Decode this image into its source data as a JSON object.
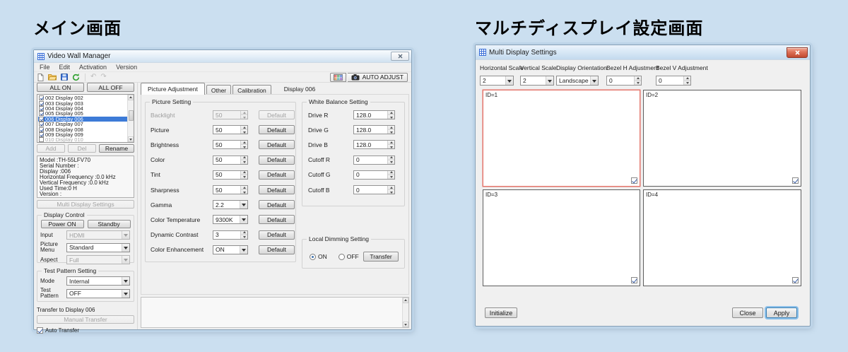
{
  "page": {
    "left_heading": "メイン画面",
    "right_heading": "マルチディスプレイ設定画面"
  },
  "colors": {
    "desktop_bg": "#cbdff0",
    "selection_blue": "#3d7bd7",
    "selected_panel_border": "#e4756b",
    "close_button_red": "#c14a30"
  },
  "icons": {
    "app": "grid-icon",
    "toolbar": [
      "new-file-icon",
      "open-file-icon",
      "save-icon",
      "refresh-icon",
      "undo-icon",
      "redo-icon"
    ],
    "auto_adjust": "camera-icon",
    "layout": "colored-grid-icon",
    "close": "x-icon"
  },
  "vwm": {
    "title": "Video Wall Manager",
    "menus": [
      "File",
      "Edit",
      "Activation",
      "Version"
    ],
    "toolbar": {
      "auto_adjust_label": "AUTO ADJUST"
    },
    "left_panel": {
      "all_on": "ALL ON",
      "all_off": "ALL OFF",
      "displays": [
        {
          "label": "002 Display 002",
          "checked": true,
          "selected": false
        },
        {
          "label": "003 Display 003",
          "checked": true,
          "selected": false
        },
        {
          "label": "004 Display 004",
          "checked": true,
          "selected": false
        },
        {
          "label": "005 Display 005",
          "checked": true,
          "selected": false
        },
        {
          "label": "006 Display 006",
          "checked": true,
          "selected": true
        },
        {
          "label": "007 Display 007",
          "checked": true,
          "selected": false
        },
        {
          "label": "008 Display 008",
          "checked": true,
          "selected": false
        },
        {
          "label": "009 Display 009",
          "checked": true,
          "selected": false
        },
        {
          "label": "010 Display 010",
          "checked": false,
          "selected": false,
          "disabled": true
        }
      ],
      "add": "Add",
      "del": "Del",
      "rename": "Rename",
      "info_lines": [
        "Model :TH-55LFV70",
        "Serial Number :",
        "Display :006",
        "Horizontal Frequency :0.0 kHz",
        "Vertical Frequency :0.0 kHz",
        "Used Time:0 H",
        "Version :"
      ],
      "multi_display_settings": "Multi Display Settings",
      "display_control": {
        "title": "Display Control",
        "power_on": "Power ON",
        "standby": "Standby",
        "input_label": "Input",
        "input_value": "HDMI",
        "picture_menu_label": "Picture Menu",
        "picture_menu_value": "Standard",
        "aspect_label": "Aspect",
        "aspect_value": "Full"
      },
      "test_pattern": {
        "title": "Test Pattern Setting",
        "mode_label": "Mode",
        "mode_value": "Internal",
        "pattern_label": "Test Pattern",
        "pattern_value": "OFF"
      },
      "transfer": {
        "title": "Transfer to Display 006",
        "manual_button": "Manual Transfer",
        "auto_checkbox": "Auto Transfer",
        "auto_checked": true
      }
    },
    "tabs": {
      "items": [
        "Picture Adjustment",
        "Other",
        "Calibration"
      ],
      "active": "Picture Adjustment",
      "display_label": "Display 006"
    },
    "picture_setting": {
      "title": "Picture Setting",
      "default_label": "Default",
      "rows": [
        {
          "label": "Backlight",
          "value": "50",
          "control": "spin",
          "disabled": true
        },
        {
          "label": "Picture",
          "value": "50",
          "control": "spin"
        },
        {
          "label": "Brightness",
          "value": "50",
          "control": "spin"
        },
        {
          "label": "Color",
          "value": "50",
          "control": "spin"
        },
        {
          "label": "Tint",
          "value": "50",
          "control": "spin"
        },
        {
          "label": "Sharpness",
          "value": "50",
          "control": "spin"
        },
        {
          "label": "Gamma",
          "value": "2.2",
          "control": "select"
        },
        {
          "label": "Color Temperature",
          "value": "9300K",
          "control": "select"
        },
        {
          "label": "Dynamic Contrast",
          "value": "3",
          "control": "spin"
        },
        {
          "label": "Color Enhancement",
          "value": "ON",
          "control": "select"
        }
      ]
    },
    "white_balance": {
      "title": "White Balance Setting",
      "rows": [
        {
          "label": "Drive R",
          "value": "128.0"
        },
        {
          "label": "Drive G",
          "value": "128.0"
        },
        {
          "label": "Drive B",
          "value": "128.0"
        },
        {
          "label": "Cutoff R",
          "value": "0"
        },
        {
          "label": "Cutoff G",
          "value": "0"
        },
        {
          "label": "Cutoff B",
          "value": "0"
        }
      ]
    },
    "local_dimming": {
      "title": "Local Dimming Setting",
      "on_label": "ON",
      "off_label": "OFF",
      "selected": "ON",
      "transfer_button": "Transfer"
    }
  },
  "mds": {
    "title": "Multi Display Settings",
    "controls": [
      {
        "label": "Horizontal Scale",
        "value": "2",
        "type": "select"
      },
      {
        "label": "Vertical Scale",
        "value": "2",
        "type": "select"
      },
      {
        "label": "Display Orientation",
        "value": "Landscape",
        "type": "select"
      },
      {
        "label": "Bezel H Adjustment",
        "value": "0",
        "type": "spin"
      },
      {
        "label": "Bezel V Adjustment",
        "value": "0",
        "type": "spin"
      }
    ],
    "panels": [
      {
        "id_label": "ID=1",
        "selected": true,
        "checked": true
      },
      {
        "id_label": "ID=2",
        "selected": false,
        "checked": true
      },
      {
        "id_label": "ID=3",
        "selected": false,
        "checked": true
      },
      {
        "id_label": "ID=4",
        "selected": false,
        "checked": true
      }
    ],
    "buttons": {
      "initialize": "Initialize",
      "close": "Close",
      "apply": "Apply"
    }
  }
}
